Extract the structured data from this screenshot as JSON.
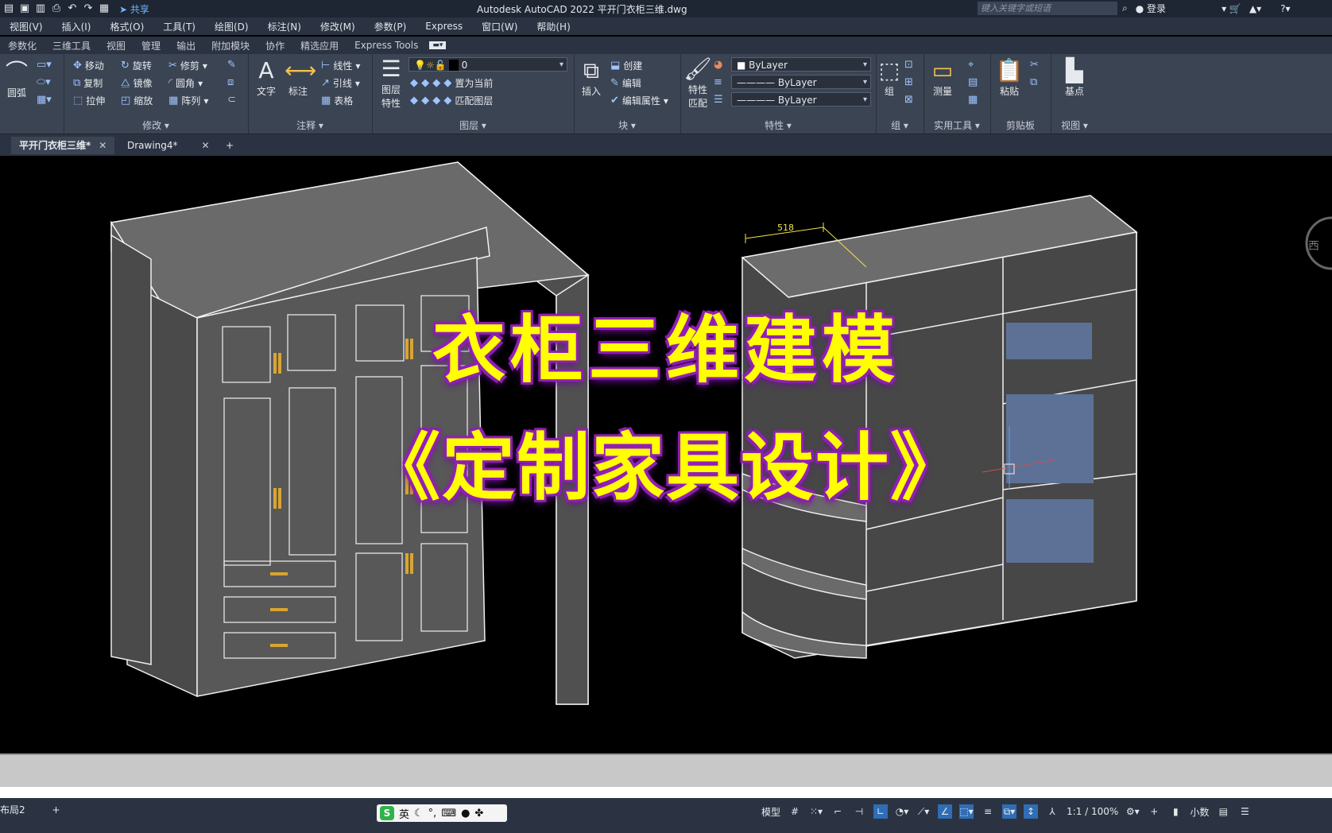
{
  "titlebar": {
    "app_title": "Autodesk AutoCAD 2022    平开门衣柜三维.dwg",
    "share_label": "共享",
    "search_placeholder": "键入关键字或短语",
    "login_label": "登录"
  },
  "menu": [
    "视图(V)",
    "插入(I)",
    "格式(O)",
    "工具(T)",
    "绘图(D)",
    "标注(N)",
    "修改(M)",
    "参数(P)",
    "Express",
    "窗口(W)",
    "帮助(H)"
  ],
  "ribbon_tabs": [
    "参数化",
    "三维工具",
    "视图",
    "管理",
    "输出",
    "附加模块",
    "协作",
    "精选应用",
    "Express Tools"
  ],
  "ribbon": {
    "draw": {
      "arc": "圆弧"
    },
    "modify": {
      "title": "修改",
      "move": "移动",
      "rotate": "旋转",
      "trim": "修剪",
      "copy": "复制",
      "mirror": "镜像",
      "fillet": "圆角",
      "stretch": "拉伸",
      "scale": "缩放",
      "array": "阵列"
    },
    "annotation": {
      "title": "注释",
      "text": "文字",
      "dimension": "标注",
      "linear": "线性",
      "leader": "引线",
      "table": "表格"
    },
    "layers": {
      "title": "图层",
      "properties_line1": "图层",
      "properties_line2": "特性",
      "current_layer": "0",
      "make_current": "置为当前",
      "match_layer": "匹配图层"
    },
    "block": {
      "title": "块",
      "insert": "插入",
      "create": "创建",
      "edit": "编辑",
      "edit_attributes": "编辑属性"
    },
    "properties": {
      "title": "特性",
      "match_line1": "特性",
      "match_line2": "匹配",
      "color": "ByLayer",
      "linetype": "ByLayer",
      "lineweight": "ByLayer"
    },
    "groups": {
      "title": "组",
      "group": "组"
    },
    "utilities": {
      "title": "实用工具",
      "measure": "测量"
    },
    "clipboard": {
      "title": "剪贴板",
      "paste": "粘贴"
    },
    "view": {
      "title": "视图",
      "base": "基点"
    }
  },
  "doc_tabs": [
    {
      "label": "平开门衣柜三维*",
      "active": true
    },
    {
      "label": "Drawing4*",
      "active": false
    }
  ],
  "drawing": {
    "dimension_value": "518",
    "viewcube_label": "西"
  },
  "overlay": {
    "line1": "衣柜三维建模",
    "line2": "《定制家具设计》"
  },
  "statusbar": {
    "layout_tab": "布局2",
    "ime_lang": "英",
    "model_label": "模型",
    "scale_label": "1:1 / 100%",
    "units_label": "小数"
  },
  "colors": {
    "ribbon_bg": "#3b4453",
    "titlebar_bg": "#1f2633",
    "overlay_text": "#ffff00",
    "overlay_glow": "#8a1fb0"
  }
}
